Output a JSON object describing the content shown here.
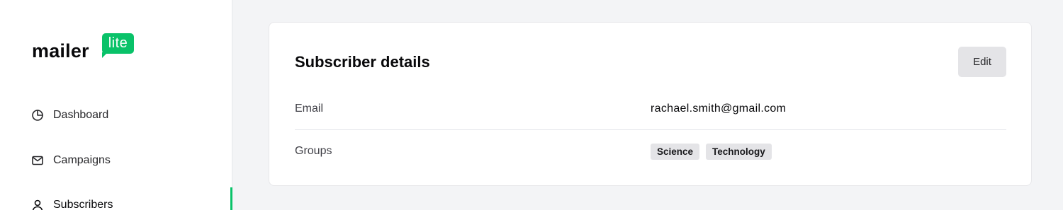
{
  "brand": {
    "name_word": "mailer",
    "badge_word": "lite",
    "accent_color": "#09c269"
  },
  "sidebar": {
    "items": [
      {
        "label": "Dashboard",
        "icon": "dashboard-pie-icon",
        "active": false
      },
      {
        "label": "Campaigns",
        "icon": "envelope-icon",
        "active": false
      },
      {
        "label": "Subscribers",
        "icon": "user-icon",
        "active": true
      }
    ]
  },
  "card": {
    "title": "Subscriber details",
    "edit_label": "Edit",
    "rows": [
      {
        "label": "Email",
        "value": "rachael.smith@gmail.com"
      },
      {
        "label": "Groups",
        "tags": [
          "Science",
          "Technology"
        ]
      }
    ]
  }
}
